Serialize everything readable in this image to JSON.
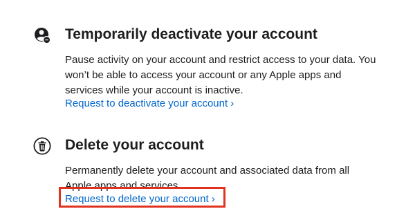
{
  "deactivate": {
    "icon": "person-pause-icon",
    "title": "Temporarily deactivate your account",
    "description": "Pause activity on your account and restrict access to your data. You won’t be able to access your account or any Apple apps and services while your account is inactive.",
    "link": "Request to deactivate your account ›"
  },
  "delete": {
    "icon": "trash-icon",
    "title": "Delete your account",
    "description": "Permanently delete your account and associated data from all Apple apps and services.",
    "link": "Request to delete your account ›"
  },
  "highlight": {
    "color": "#e0321e",
    "target": "delete-account-link"
  },
  "colors": {
    "text": "#1d1d1f",
    "link": "#0066cc"
  }
}
